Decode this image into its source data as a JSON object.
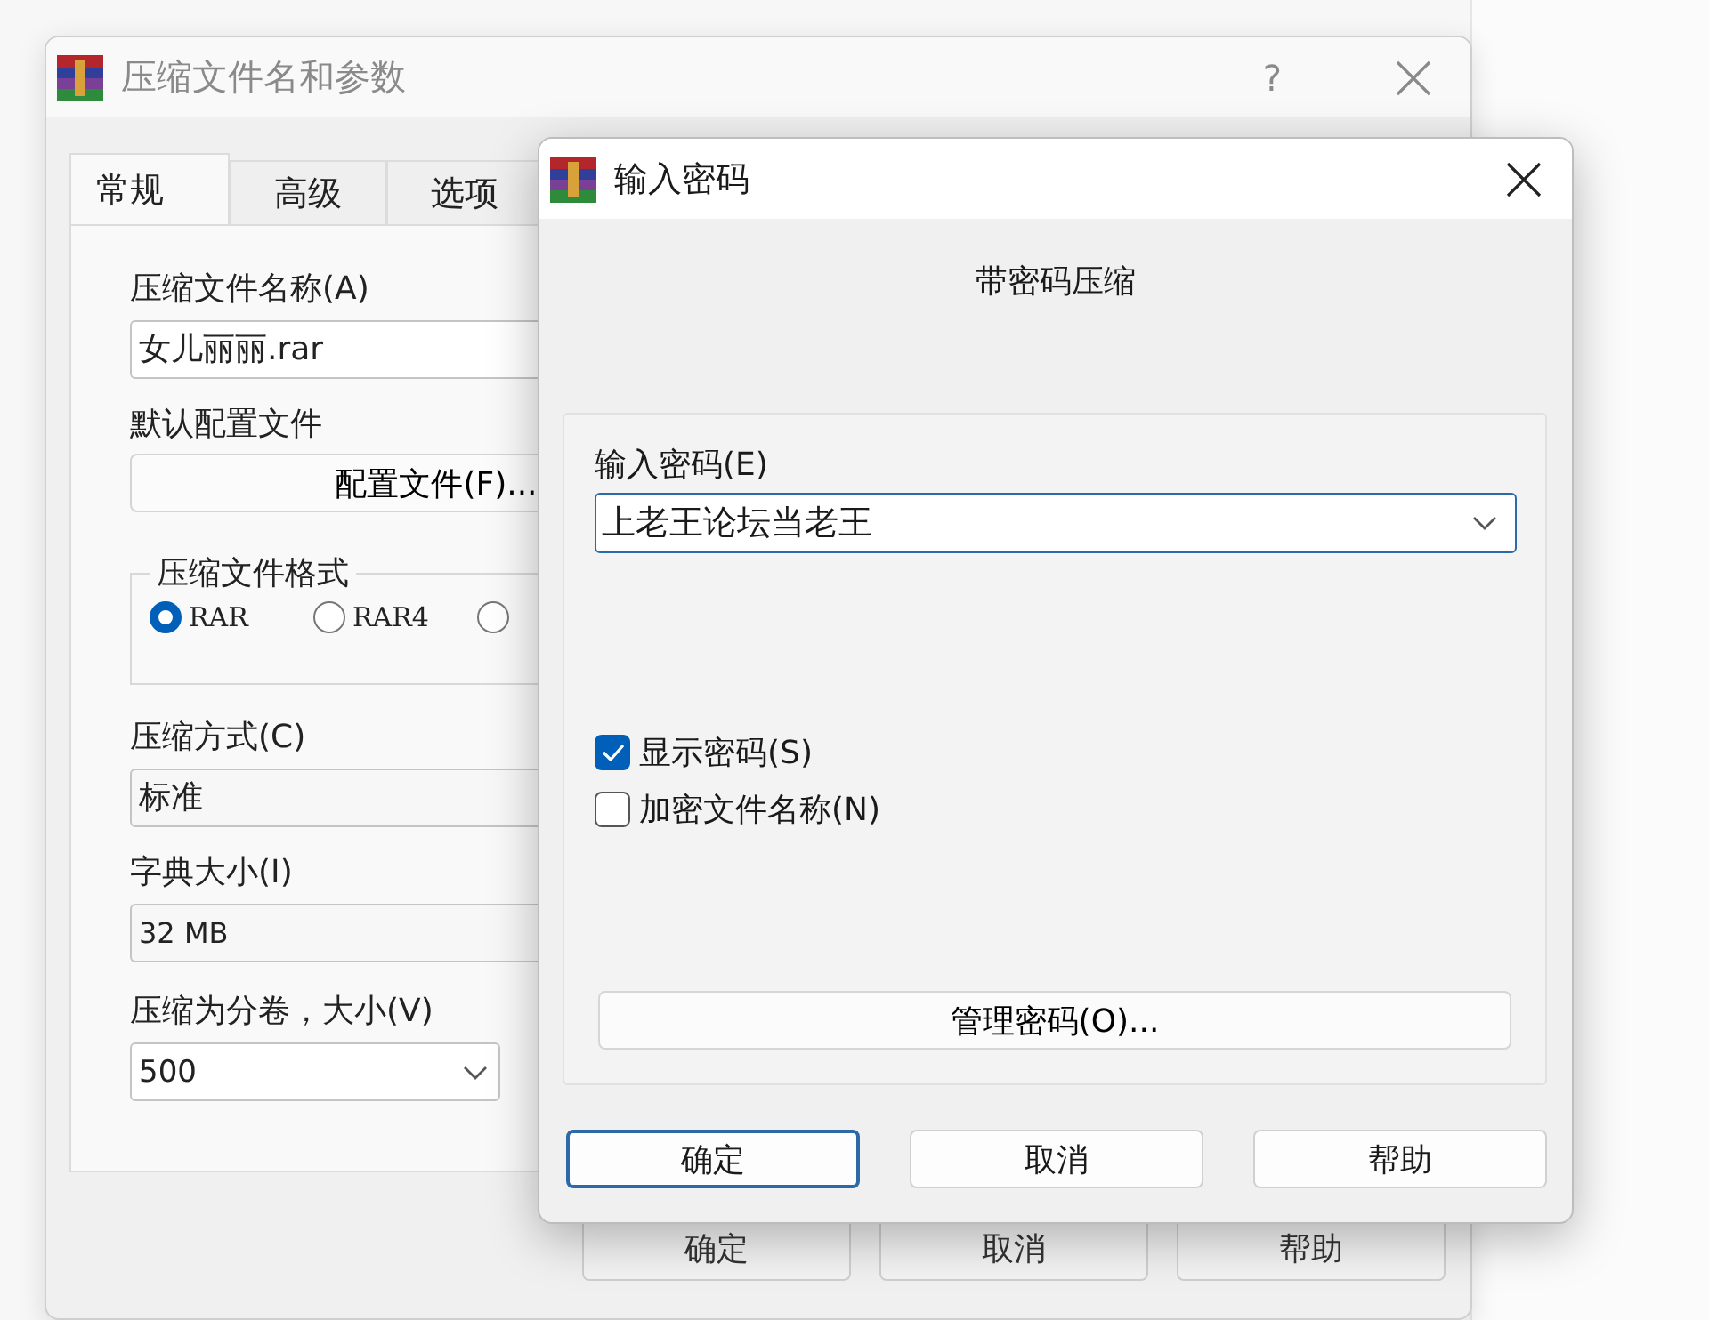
{
  "main_window": {
    "title": "压缩文件名和参数",
    "help_button": "?",
    "tabs": [
      {
        "label": "常规",
        "selected": true
      },
      {
        "label": "高级",
        "selected": false
      },
      {
        "label": "选项",
        "selected": false
      }
    ],
    "archive_name": {
      "label": "压缩文件名称(A)",
      "value": "女儿丽丽.rar"
    },
    "profile": {
      "label": "默认配置文件",
      "button": "配置文件(F)..."
    },
    "format": {
      "label": "压缩文件格式",
      "options": [
        {
          "label": "RAR",
          "selected": true
        },
        {
          "label": "RAR4",
          "selected": false
        },
        {
          "selected": false
        }
      ]
    },
    "method": {
      "label": "压缩方式(C)",
      "value": "标准"
    },
    "dictionary": {
      "label": "字典大小(I)",
      "value": "32 MB"
    },
    "split": {
      "label": "压缩为分卷，大小(V)",
      "value": "500"
    },
    "buttons": [
      "确定",
      "取消",
      "帮助"
    ]
  },
  "password_dialog": {
    "title": "输入密码",
    "heading": "带密码压缩",
    "password": {
      "label": "输入密码(E)",
      "value": "上老王论坛当老王"
    },
    "options": [
      {
        "label": "显示密码(S)",
        "checked": true
      },
      {
        "label": "加密文件名称(N)",
        "checked": false
      }
    ],
    "manage_button": "管理密码(O)...",
    "buttons": [
      {
        "label": "确定",
        "default": true
      },
      {
        "label": "取消",
        "default": false
      },
      {
        "label": "帮助",
        "default": false
      }
    ]
  }
}
